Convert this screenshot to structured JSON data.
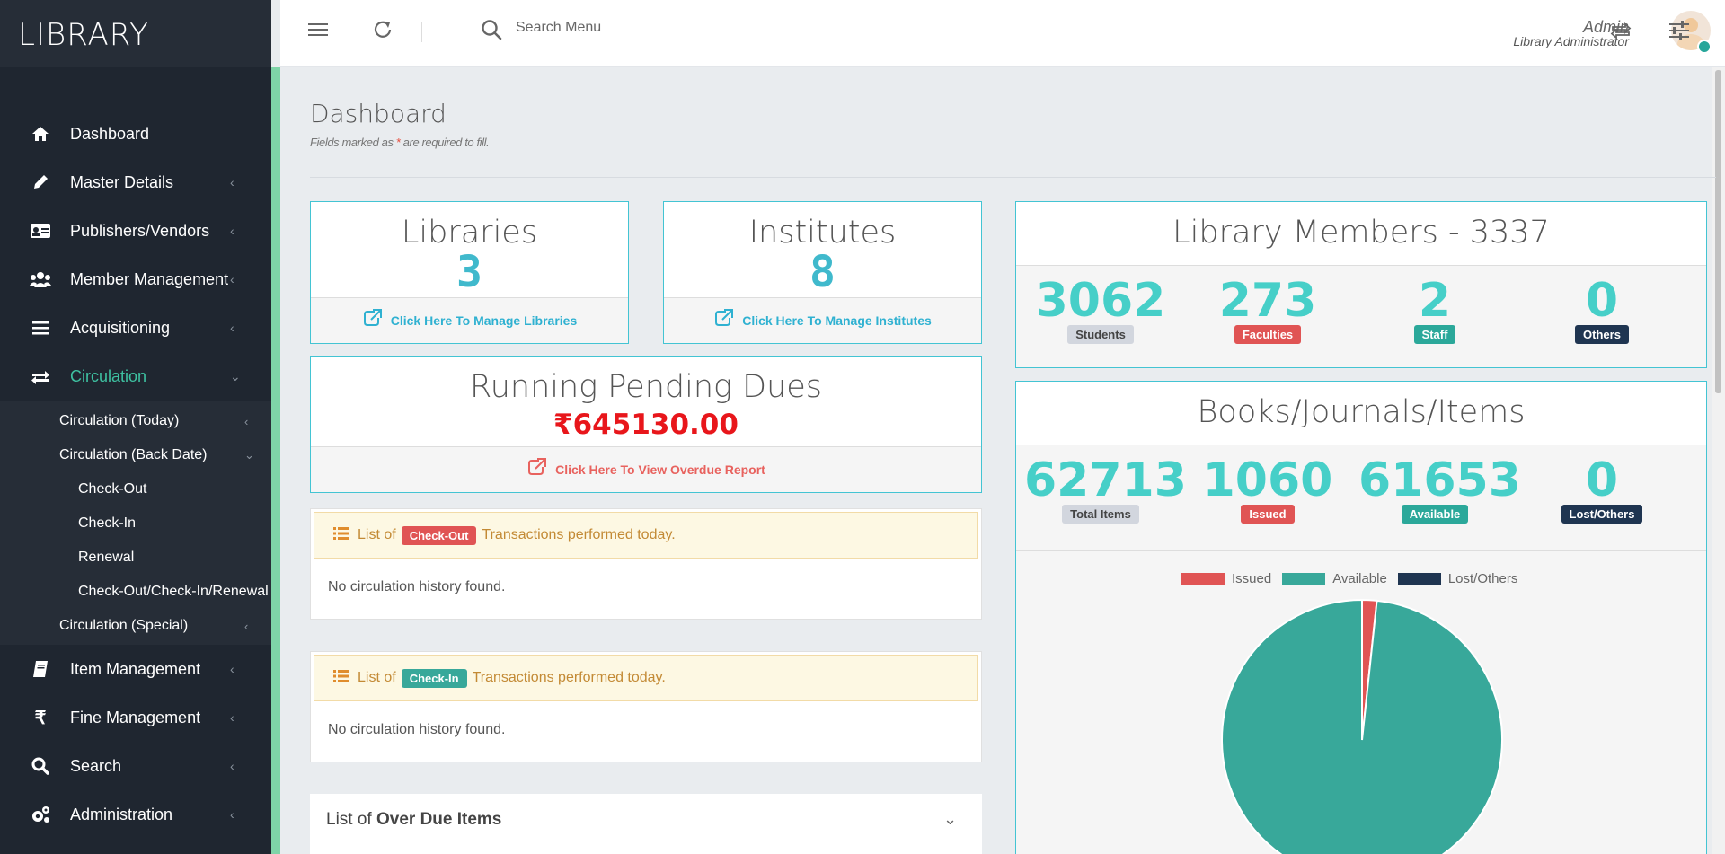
{
  "app": {
    "logo": "LIBRARY"
  },
  "sidebar": {
    "items": [
      {
        "label": "Dashboard",
        "icon": "home-icon",
        "chevron": false
      },
      {
        "label": "Master Details",
        "icon": "pencil-icon",
        "chevron": true
      },
      {
        "label": "Publishers/Vendors",
        "icon": "id-card-icon",
        "chevron": true
      },
      {
        "label": "Member Management",
        "icon": "users-icon",
        "chevron": true
      },
      {
        "label": "Acquisitioning",
        "icon": "list-icon",
        "chevron": true
      },
      {
        "label": "Circulation",
        "icon": "exchange-icon",
        "chevron": true,
        "active": true
      }
    ],
    "circulation_sub": [
      {
        "label": "Circulation (Today)",
        "level": 1
      },
      {
        "label": "Circulation (Back Date)",
        "level": 1,
        "expanded": true
      },
      {
        "label": "Check-Out",
        "level": 2
      },
      {
        "label": "Check-In",
        "level": 2
      },
      {
        "label": "Renewal",
        "level": 2
      },
      {
        "label": "Check-Out/Check-In/Renewal",
        "level": 2
      },
      {
        "label": "Circulation (Special)",
        "level": 1
      }
    ],
    "items_after": [
      {
        "label": "Item Management",
        "icon": "book-icon"
      },
      {
        "label": "Fine Management",
        "icon": "rupee-icon"
      },
      {
        "label": "Search",
        "icon": "search-icon"
      },
      {
        "label": "Administration",
        "icon": "cogs-icon"
      }
    ]
  },
  "header": {
    "search_placeholder": "Search Menu",
    "user_name": "Admin",
    "user_role": "Library Administrator"
  },
  "page": {
    "title": "Dashboard",
    "subtitle_before": "Fields marked as ",
    "subtitle_star": "*",
    "subtitle_after": " are required to fill."
  },
  "libraries": {
    "title": "Libraries",
    "count": "3",
    "link": "Click Here To Manage Libraries"
  },
  "institutes": {
    "title": "Institutes",
    "count": "8",
    "link": "Click Here To Manage Institutes"
  },
  "dues": {
    "title": "Running Pending Dues",
    "amount": "₹645130.00",
    "link": "Click Here To View Overdue Report"
  },
  "members": {
    "title": "Library Members - 3337",
    "stats": [
      {
        "value": "3062",
        "label": "Students"
      },
      {
        "value": "273",
        "label": "Faculties"
      },
      {
        "value": "2",
        "label": "Staff"
      },
      {
        "value": "0",
        "label": "Others"
      }
    ]
  },
  "items": {
    "title": "Books/Journals/Items",
    "stats": [
      {
        "value": "62713",
        "label": "Total Items"
      },
      {
        "value": "1060",
        "label": "Issued"
      },
      {
        "value": "61653",
        "label": "Available"
      },
      {
        "value": "0",
        "label": "Lost/Others"
      }
    ]
  },
  "checkout_alert": {
    "prefix": "List of",
    "tag": "Check-Out",
    "suffix": "Transactions performed today.",
    "empty": "No circulation history found."
  },
  "checkin_alert": {
    "prefix": "List of",
    "tag": "Check-In",
    "suffix": "Transactions performed today.",
    "empty": "No circulation history found."
  },
  "overdue": {
    "prefix": "List of ",
    "strong": "Over Due Items"
  },
  "colors": {
    "issued": "#e05454",
    "available": "#38a89a",
    "lost": "#1f3551",
    "accent": "#40b9cc"
  },
  "chart_data": {
    "type": "pie",
    "labels": [
      "Issued",
      "Available",
      "Lost/Others"
    ],
    "values": [
      1060,
      61653,
      0
    ],
    "legend": "top"
  }
}
